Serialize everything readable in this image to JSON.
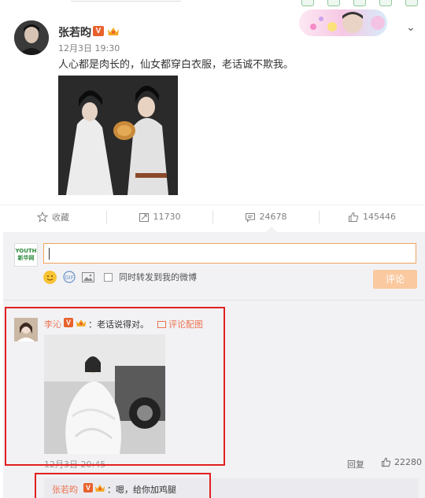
{
  "post": {
    "username": "张若昀",
    "verified_badge": "V",
    "timestamp": "12月3日 19:30",
    "text": "人心都是肉长的，仙女都穿白衣服，老话诚不欺我。"
  },
  "actions": {
    "favorite_label": "收藏",
    "repost_count": "11730",
    "comment_count": "24678",
    "like_count": "145446"
  },
  "composer": {
    "avatar_text_top": "YOUTH",
    "avatar_text_bottom": "新华网",
    "repost_option_label": "同时转发到我的微博",
    "submit_label": "评论"
  },
  "comment": {
    "username": "李沁",
    "verified_badge": "V",
    "text": "：老话说得对。",
    "image_link_label": "评论配图",
    "timestamp": "12月3日 20:45",
    "reply_label": "回复",
    "like_count": "22280"
  },
  "sub_reply": {
    "username": "张若昀",
    "verified_badge": "V",
    "text": "：嗯，给你加鸡腿"
  },
  "colors": {
    "accent_orange": "#eb7350",
    "vip_orange": "#e8612c",
    "highlight_red": "#e02020",
    "comment_bg": "#f2f2f5"
  }
}
